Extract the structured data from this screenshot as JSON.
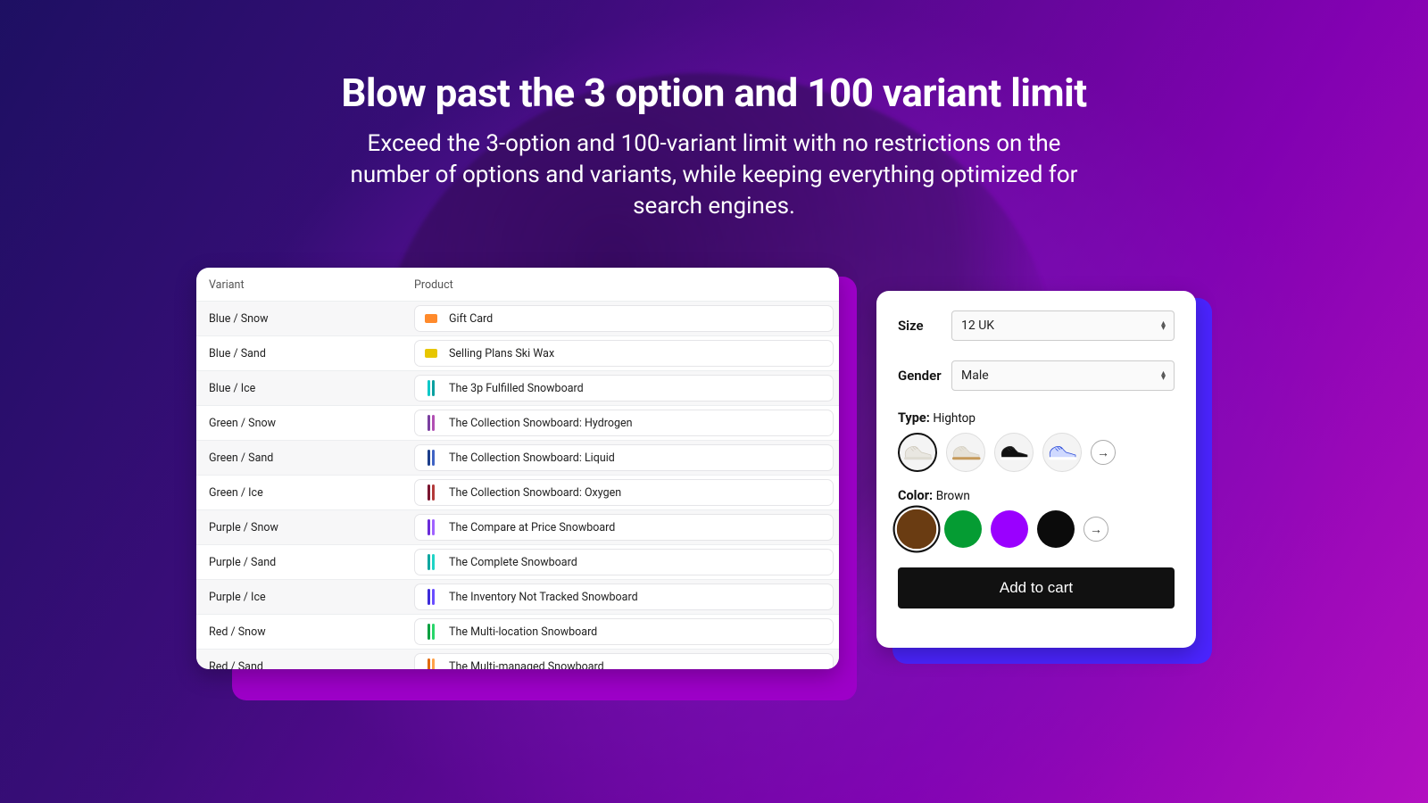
{
  "hero": {
    "title": "Blow past the 3 option and 100 variant limit",
    "subtitle": "Exceed the 3-option and 100-variant limit with no restrictions on the number of options and variants, while keeping everything optimized for search engines."
  },
  "table": {
    "headers": {
      "variant": "Variant",
      "product": "Product"
    },
    "rows": [
      {
        "variant": "Blue / Snow",
        "product": "Gift Card",
        "thumb": "orange-square"
      },
      {
        "variant": "Blue / Sand",
        "product": "Selling Plans Ski Wax",
        "thumb": "yellow-square"
      },
      {
        "variant": "Blue / Ice",
        "product": "The 3p Fulfilled Snowboard",
        "thumb": "board-teal"
      },
      {
        "variant": "Green / Snow",
        "product": "The Collection Snowboard: Hydrogen",
        "thumb": "board-purplish"
      },
      {
        "variant": "Green / Sand",
        "product": "The Collection Snowboard: Liquid",
        "thumb": "board-navy"
      },
      {
        "variant": "Green / Ice",
        "product": "The Collection Snowboard: Oxygen",
        "thumb": "board-maroon"
      },
      {
        "variant": "Purple / Snow",
        "product": "The Compare at Price Snowboard",
        "thumb": "board-violet"
      },
      {
        "variant": "Purple / Sand",
        "product": "The Complete Snowboard",
        "thumb": "board-teal2"
      },
      {
        "variant": "Purple / Ice",
        "product": "The Inventory Not Tracked Snowboard",
        "thumb": "board-indigo"
      },
      {
        "variant": "Red / Snow",
        "product": "The Multi-location Snowboard",
        "thumb": "board-green"
      },
      {
        "variant": "Red / Sand",
        "product": "The Multi-managed Snowboard",
        "thumb": "board-orange"
      }
    ]
  },
  "options_form": {
    "size": {
      "label": "Size",
      "value": "12 UK"
    },
    "gender": {
      "label": "Gender",
      "value": "Male"
    },
    "type": {
      "label": "Type:",
      "value": "Hightop",
      "swatches": [
        {
          "name": "hightop-white",
          "selected": true,
          "body": "#e9e7e1",
          "sole": "#dedbd2",
          "accent": "#cfcabd"
        },
        {
          "name": "hightop-cream",
          "selected": false,
          "body": "#e6e2d8",
          "sole": "#c69a5b",
          "accent": "#d6d1c6"
        },
        {
          "name": "hightop-black",
          "selected": false,
          "body": "#111111",
          "sole": "#ffffff",
          "accent": "#2d2d2d"
        },
        {
          "name": "hightop-blue",
          "selected": false,
          "body": "#cfd9ff",
          "sole": "#ffffff",
          "accent": "#2b4bd8"
        }
      ]
    },
    "color": {
      "label": "Color:",
      "value": "Brown",
      "swatches": [
        {
          "name": "brown",
          "hex": "#6a3c12",
          "selected": true
        },
        {
          "name": "green",
          "hex": "#059c33",
          "selected": false
        },
        {
          "name": "purple",
          "hex": "#9a00ff",
          "selected": false
        },
        {
          "name": "black",
          "hex": "#0b0b0b",
          "selected": false
        }
      ]
    },
    "add_to_cart": "Add to cart",
    "more_arrow": "→"
  }
}
